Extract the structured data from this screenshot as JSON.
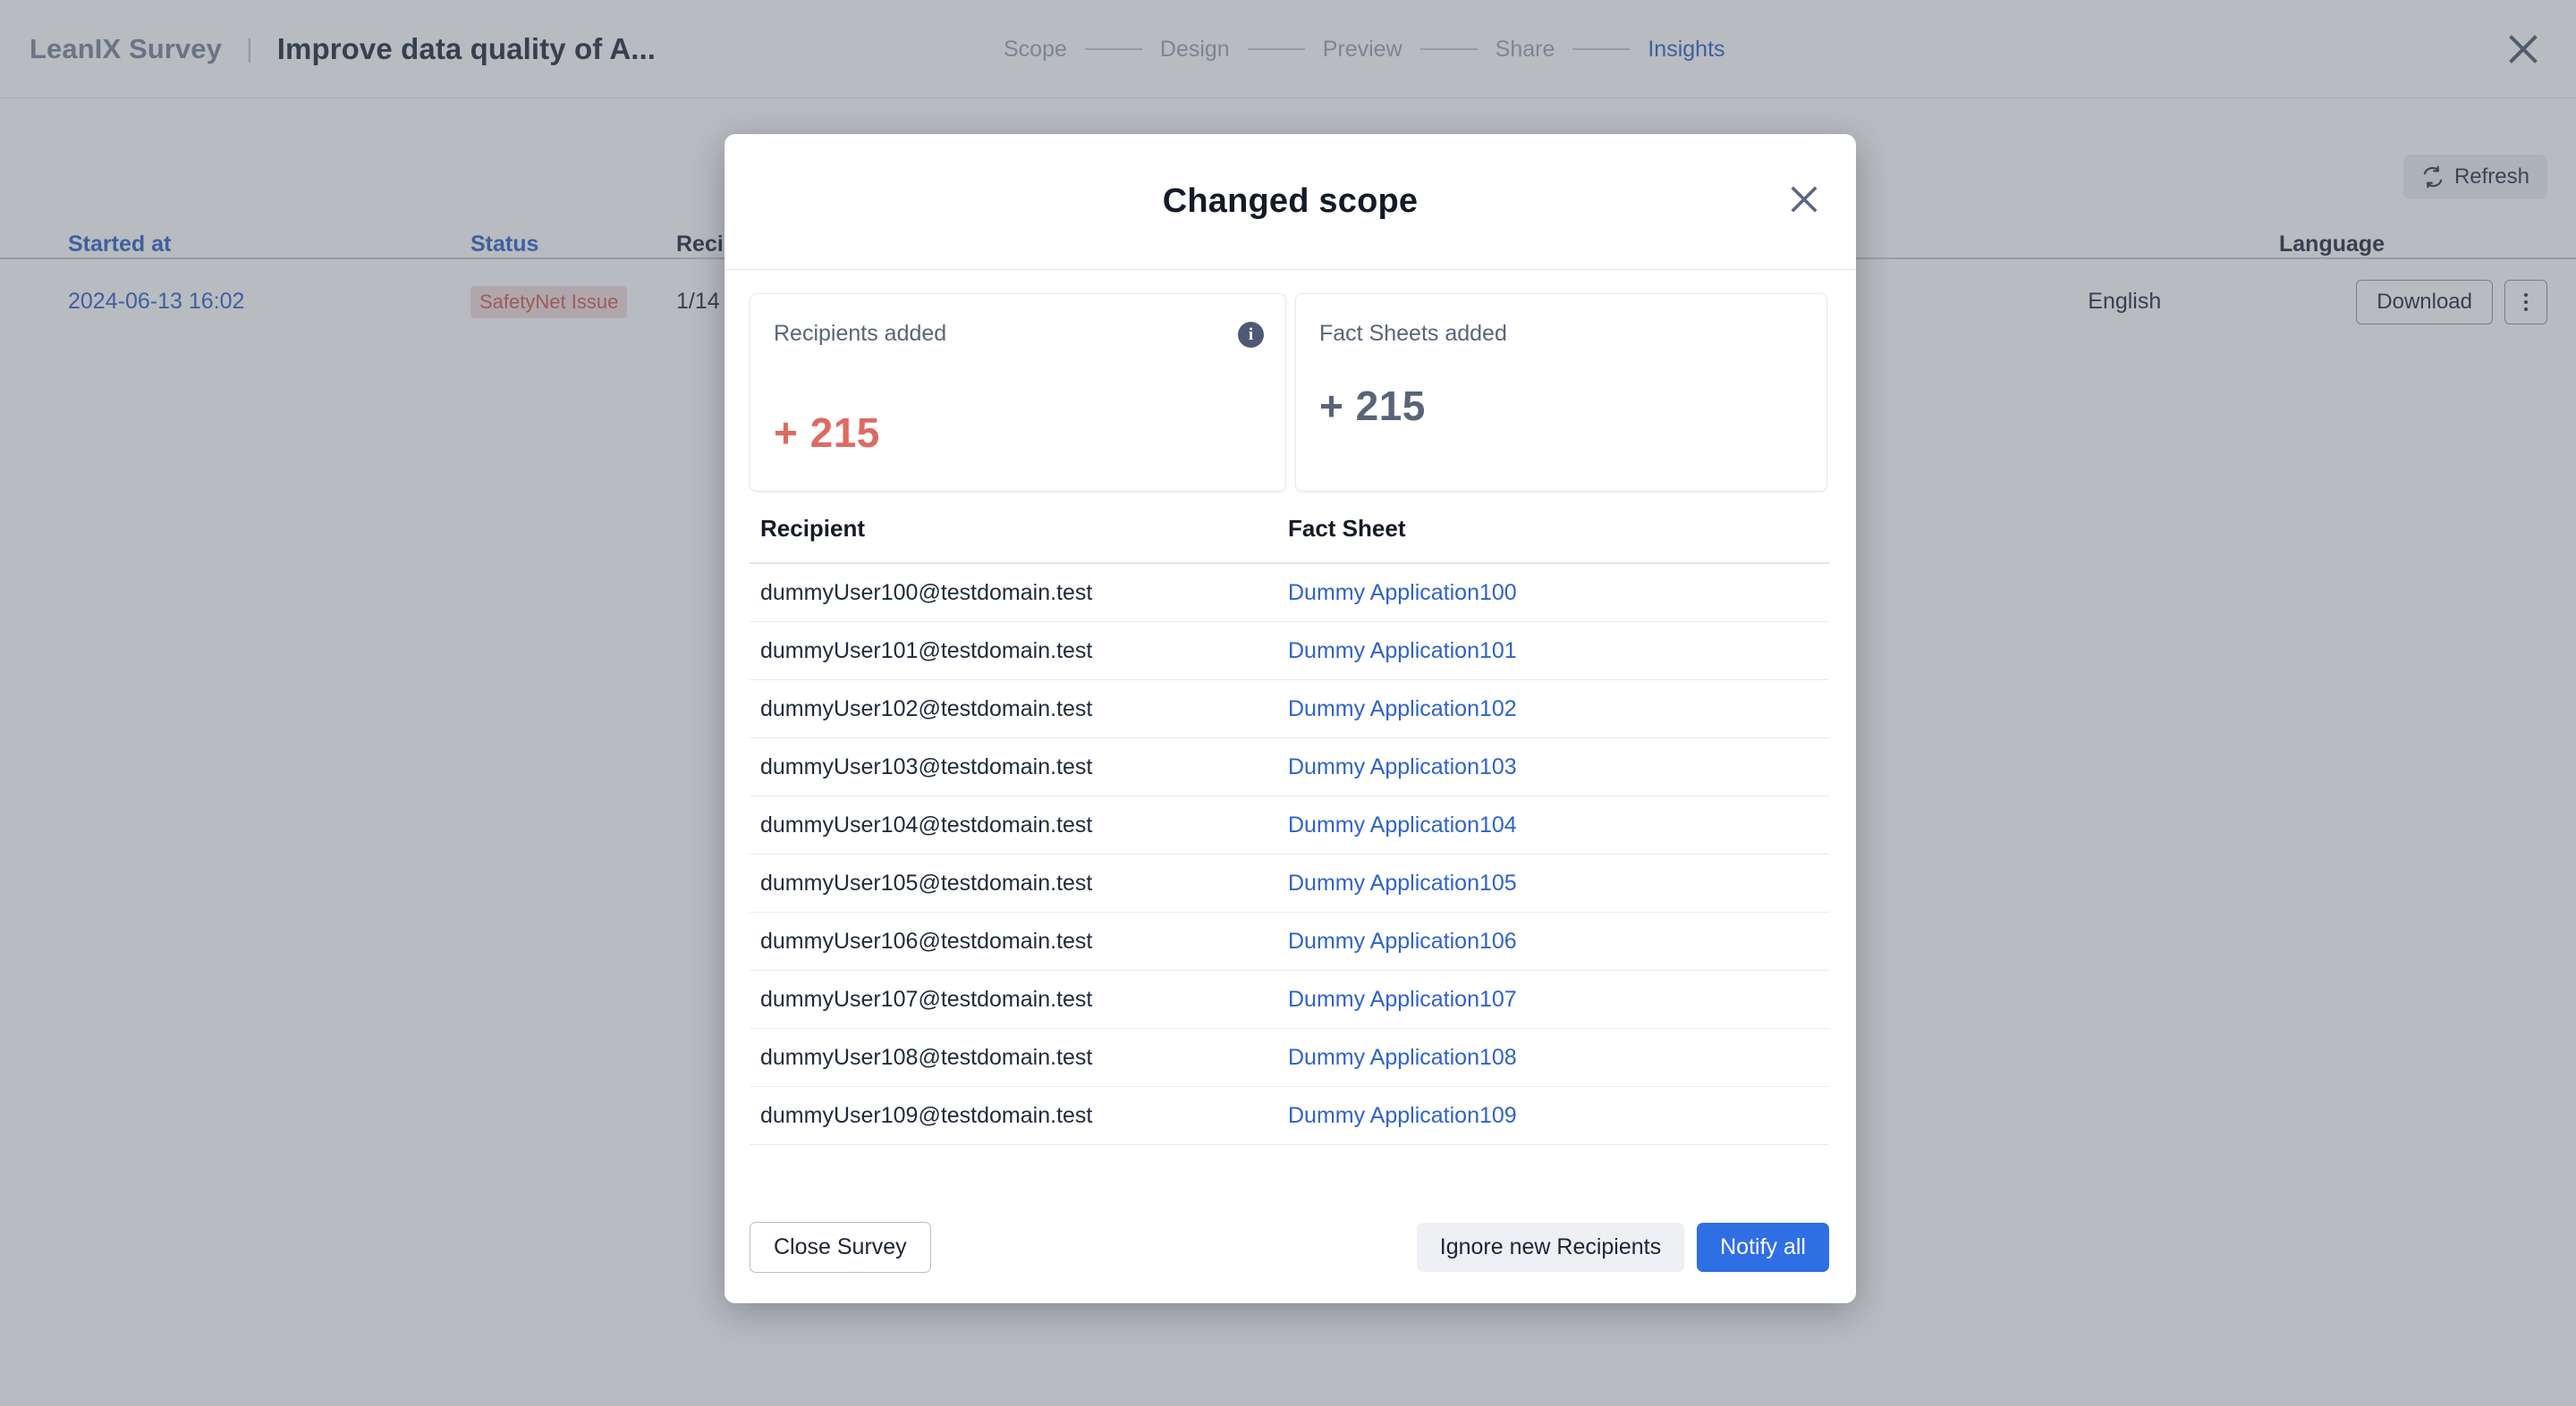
{
  "app": {
    "brand": "LeanIX Survey",
    "brand_separator": "|",
    "survey_title": "Improve data quality of A...",
    "close_icon": "close-icon",
    "stepper": [
      {
        "label": "Scope",
        "active": false
      },
      {
        "label": "Design",
        "active": false
      },
      {
        "label": "Preview",
        "active": false
      },
      {
        "label": "Share",
        "active": false
      },
      {
        "label": "Insights",
        "active": true
      }
    ],
    "refresh": {
      "label": "Refresh",
      "icon": "refresh-icon"
    },
    "accent_blue": "#2f63c8",
    "accent_red": "#cf5c52"
  },
  "background_table": {
    "columns": [
      {
        "key": "started_at",
        "label": "Started at",
        "sortable": true
      },
      {
        "key": "status",
        "label": "Status",
        "sortable": true
      },
      {
        "key": "recipients",
        "label": "Recipi",
        "sortable": false
      },
      {
        "key": "language",
        "label": "Language",
        "sortable": false
      }
    ],
    "rows": [
      {
        "started_at": "2024-06-13 16:02",
        "status": "SafetyNet Issue",
        "recipients": "1/14",
        "language": "English",
        "download_label": "Download",
        "more_icon": "kebab-menu-icon"
      }
    ]
  },
  "modal": {
    "title": "Changed scope",
    "close_icon": "close-icon",
    "stats": [
      {
        "label": "Recipients added",
        "value": "+ 215",
        "color": "#dd6b62",
        "has_info": true,
        "info_icon": "info-icon",
        "info_glyph": "i"
      },
      {
        "label": "Fact Sheets added",
        "value": "+ 215",
        "color": "#5a6478",
        "has_info": false
      }
    ],
    "table": {
      "columns": [
        {
          "key": "recipient",
          "label": "Recipient"
        },
        {
          "key": "fact_sheet",
          "label": "Fact Sheet"
        }
      ],
      "rows": [
        {
          "recipient": "dummyUser100@testdomain.test",
          "fact_sheet": "Dummy Application100"
        },
        {
          "recipient": "dummyUser101@testdomain.test",
          "fact_sheet": "Dummy Application101"
        },
        {
          "recipient": "dummyUser102@testdomain.test",
          "fact_sheet": "Dummy Application102"
        },
        {
          "recipient": "dummyUser103@testdomain.test",
          "fact_sheet": "Dummy Application103"
        },
        {
          "recipient": "dummyUser104@testdomain.test",
          "fact_sheet": "Dummy Application104"
        },
        {
          "recipient": "dummyUser105@testdomain.test",
          "fact_sheet": "Dummy Application105"
        },
        {
          "recipient": "dummyUser106@testdomain.test",
          "fact_sheet": "Dummy Application106"
        },
        {
          "recipient": "dummyUser107@testdomain.test",
          "fact_sheet": "Dummy Application107"
        },
        {
          "recipient": "dummyUser108@testdomain.test",
          "fact_sheet": "Dummy Application108"
        },
        {
          "recipient": "dummyUser109@testdomain.test",
          "fact_sheet": "Dummy Application109"
        }
      ]
    },
    "scrollbar": {
      "thumb_position_percent": 3,
      "thumb_size_percent": 5
    },
    "footer": {
      "close_survey_label": "Close Survey",
      "ignore_label": "Ignore new Recipients",
      "notify_label": "Notify all",
      "notify_color": "#2f6fe4"
    }
  }
}
